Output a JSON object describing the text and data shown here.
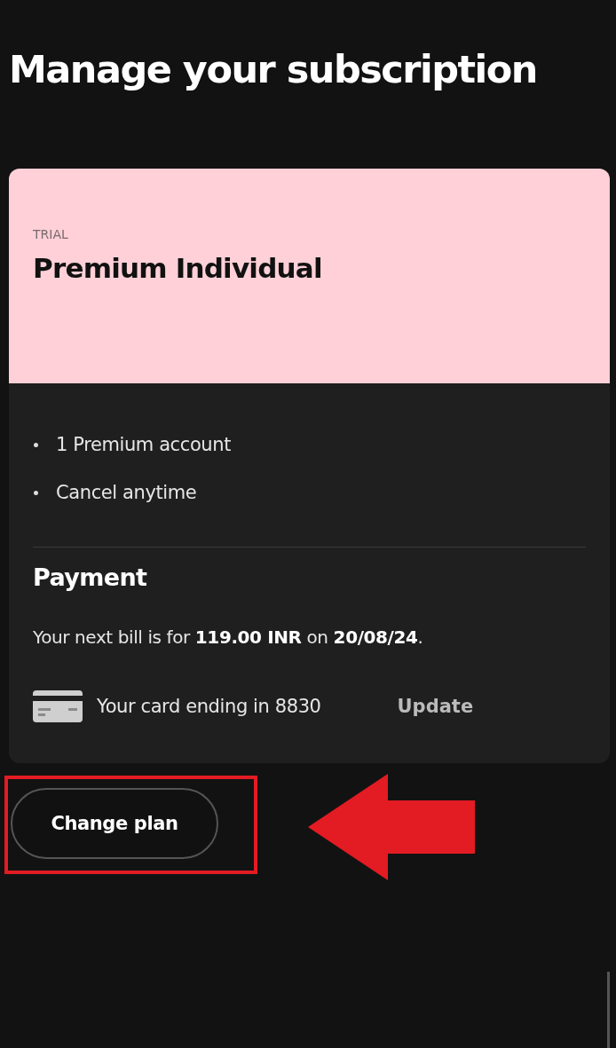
{
  "title": "Manage your subscription",
  "plan": {
    "tag": "TRIAL",
    "name": "Premium Individual"
  },
  "features": [
    "1 Premium account",
    "Cancel anytime"
  ],
  "payment": {
    "heading": "Payment",
    "bill": "Your next bill is for **119.00 INR** on **20/08/24**.",
    "card_text": "Your card ending in 8830",
    "update_link": "Update"
  },
  "button": "Change plan",
  "annotation": {
    "kind": "box-and-arrow"
  }
}
